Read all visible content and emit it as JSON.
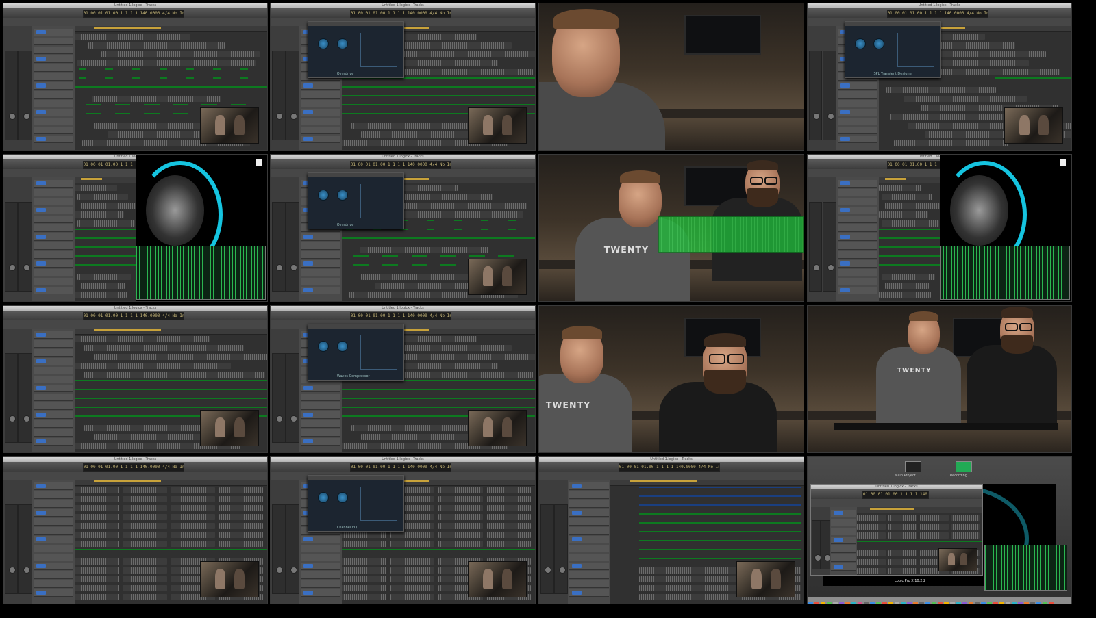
{
  "app": {
    "window_title": "Untitled 1.logicx - Tracks",
    "lcd_readout": "01 00 01 01.00   1 1 1 1   140.0000   4/4   No In"
  },
  "grid": {
    "rows": 4,
    "columns": 4
  },
  "cells": [
    {
      "kind": "daw",
      "plugin": "",
      "scene": "green-regions"
    },
    {
      "kind": "daw",
      "plugin": "Overdrive",
      "scene": "green-band"
    },
    {
      "kind": "camera",
      "scene": "single-presenter-closeup"
    },
    {
      "kind": "daw",
      "plugin": "SPL Transient Designer",
      "scene": "eq-plugin"
    },
    {
      "kind": "daw-orb",
      "plugin": "",
      "scene": "orb-overlay"
    },
    {
      "kind": "daw",
      "plugin": "Overdrive",
      "scene": "green-regions"
    },
    {
      "kind": "camera",
      "scene": "two-presenters-overlay"
    },
    {
      "kind": "daw-orb",
      "plugin": "",
      "scene": "orb-overlay"
    },
    {
      "kind": "daw",
      "plugin": "",
      "scene": "green-band"
    },
    {
      "kind": "daw",
      "plugin": "Waves Compressor",
      "scene": "green-band"
    },
    {
      "kind": "camera",
      "scene": "two-presenters-desk"
    },
    {
      "kind": "camera",
      "scene": "two-presenters-wide"
    },
    {
      "kind": "daw",
      "plugin": "",
      "scene": "dense-regions"
    },
    {
      "kind": "daw",
      "plugin": "Channel EQ",
      "scene": "dense-regions"
    },
    {
      "kind": "daw",
      "plugin": "",
      "scene": "blue-green-regions"
    },
    {
      "kind": "desktop",
      "scene": "launch-screen"
    }
  ],
  "camera_text": {
    "shirt_logo": "TWENTY"
  },
  "desktop": {
    "app_caption": "Logic Pro X 10.2.2",
    "top_icon_left": "Main Project",
    "top_icon_right": "Recording"
  },
  "colors": {
    "region_green": "#20c23c",
    "region_blue": "#2d6fd0",
    "lcd_text": "#c9b97a",
    "orb_ring": "#15c4e0"
  }
}
